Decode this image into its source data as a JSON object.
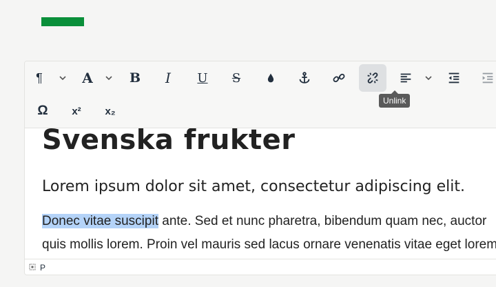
{
  "brand": {
    "logo_color": "#0a8f3a"
  },
  "toolbar": {
    "row1": [
      {
        "name": "paragraph-button",
        "icon": "pilcrow-icon",
        "glyph": "¶",
        "has_dropdown": true
      },
      {
        "name": "font-color-button",
        "icon": "text-color-icon",
        "glyph": "A",
        "has_dropdown": true
      },
      {
        "name": "bold-button",
        "icon": "bold-icon",
        "glyph": "B"
      },
      {
        "name": "italic-button",
        "icon": "italic-icon",
        "glyph": "I"
      },
      {
        "name": "underline-button",
        "icon": "underline-icon",
        "glyph": "U"
      },
      {
        "name": "strikethrough-button",
        "icon": "strikethrough-icon",
        "glyph": "S"
      },
      {
        "name": "highlight-button",
        "icon": "drop-icon"
      },
      {
        "name": "anchor-button",
        "icon": "anchor-icon"
      },
      {
        "name": "link-button",
        "icon": "link-icon"
      },
      {
        "name": "unlink-button",
        "icon": "unlink-icon",
        "active": true
      },
      {
        "name": "align-button",
        "icon": "align-left-icon",
        "has_dropdown": true
      },
      {
        "name": "outdent-button",
        "icon": "outdent-icon"
      },
      {
        "name": "indent-button",
        "icon": "indent-icon"
      }
    ],
    "row2": [
      {
        "name": "special-char-button",
        "icon": "omega-icon",
        "glyph": "Ω"
      },
      {
        "name": "superscript-button",
        "icon": "superscript-icon",
        "glyph": "x²"
      },
      {
        "name": "subscript-button",
        "icon": "subscript-icon",
        "glyph": "x₂"
      }
    ],
    "tooltip": "Unlink"
  },
  "content": {
    "heading1": "Svenska frukter",
    "heading2": "Lorem ipsum dolor sit amet, consectetur adipiscing elit.",
    "para_selected": "Donec vitae suscipit",
    "para_rest_line1": " ante. Sed et nunc pharetra, bibendum quam nec, auctor",
    "para_line2": "quis mollis lorem. Proin vel mauris sed lacus ornare venenatis vitae eget lorem."
  },
  "statusbar": {
    "path": "P"
  },
  "colors": {
    "selection": "#b4d3f8",
    "active_button": "#dee0e2",
    "tooltip_bg": "#5a5a5a"
  }
}
